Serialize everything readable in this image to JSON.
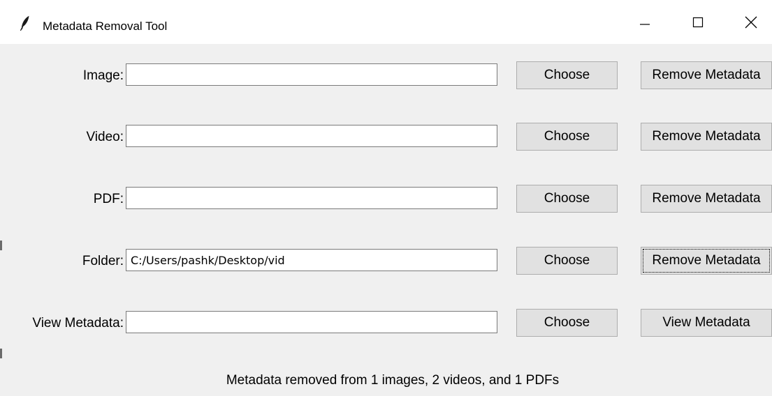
{
  "window": {
    "title": "Metadata Removal Tool",
    "icon": "feather-icon",
    "controls": {
      "minimize_icon": "minimize-icon",
      "maximize_icon": "maximize-icon",
      "close_icon": "close-icon"
    }
  },
  "rows": [
    {
      "label": "Image:",
      "value": "",
      "choose_label": "Choose",
      "action_label": "Remove Metadata"
    },
    {
      "label": "Video:",
      "value": "",
      "choose_label": "Choose",
      "action_label": "Remove Metadata"
    },
    {
      "label": "PDF:",
      "value": "",
      "choose_label": "Choose",
      "action_label": "Remove Metadata"
    },
    {
      "label": "Folder:",
      "value": "C:/Users/pashk/Desktop/vid",
      "choose_label": "Choose",
      "action_label": "Remove Metadata"
    },
    {
      "label": "View Metadata:",
      "value": "",
      "choose_label": "Choose",
      "action_label": "View Metadata"
    }
  ],
  "status": {
    "message": "Metadata removed from 1 images, 2 videos, and 1 PDFs"
  },
  "colors": {
    "window_background": "#f0f0f0",
    "titlebar_background": "#ffffff",
    "button_face": "#e1e1e1",
    "button_border": "#adadad",
    "entry_border": "#7a7a7a"
  }
}
